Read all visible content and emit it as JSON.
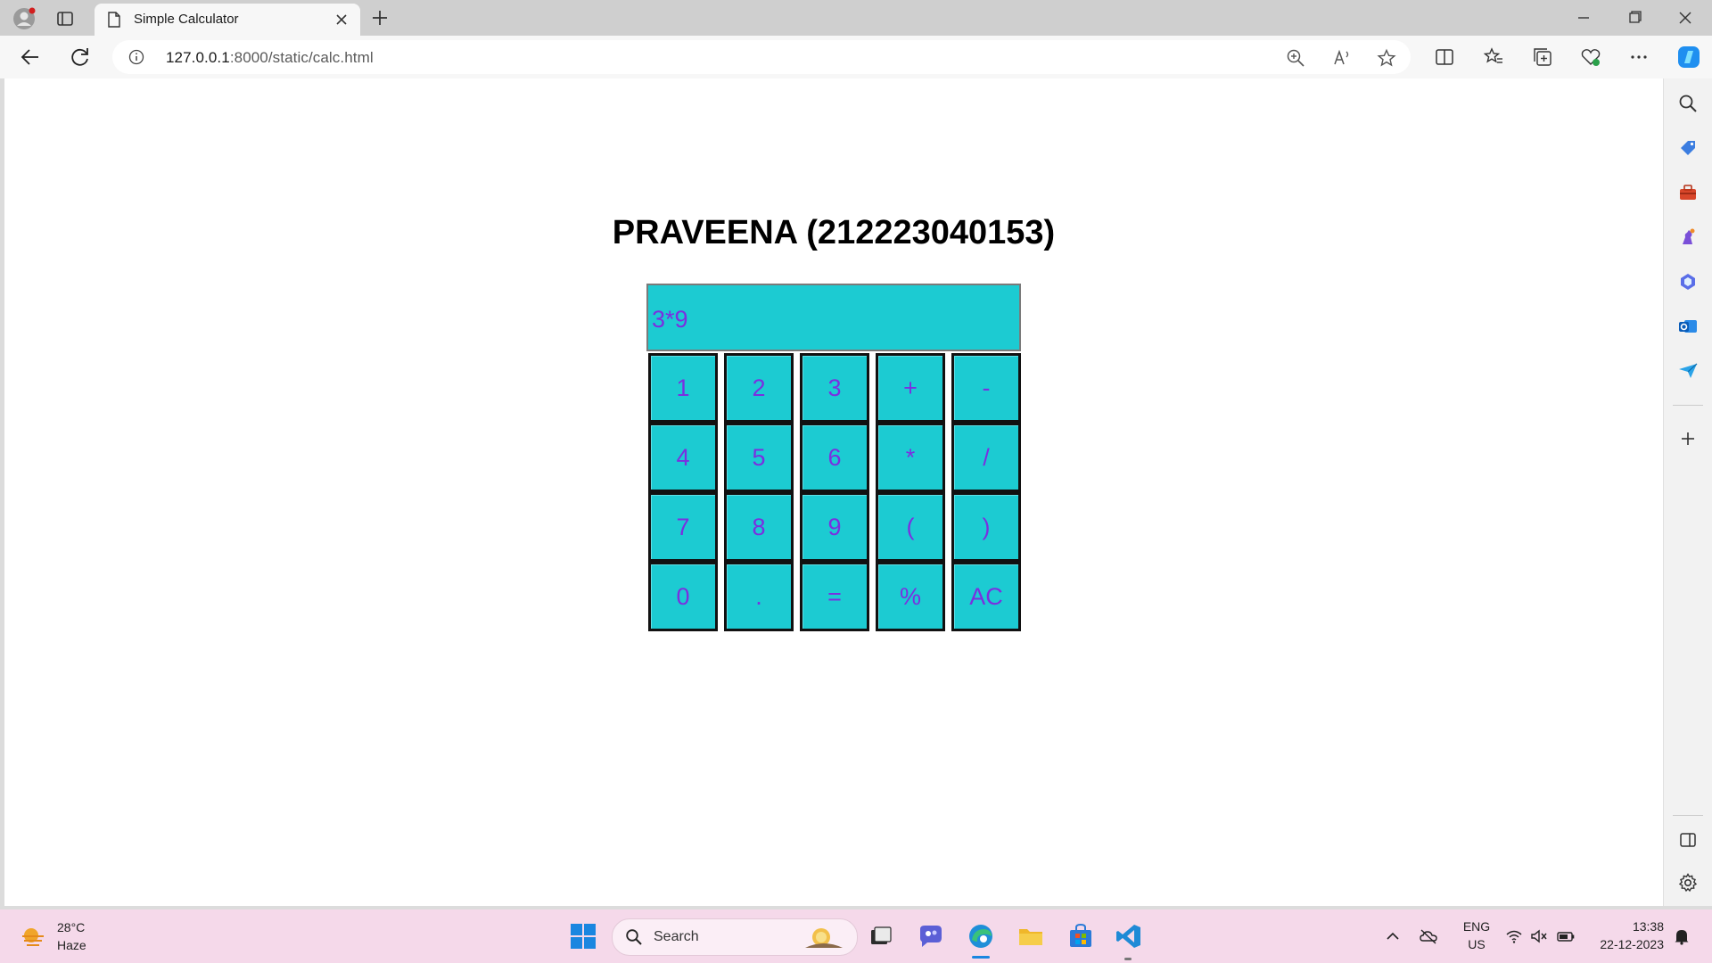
{
  "browser": {
    "tab_title": "Simple Calculator",
    "url_host": "127.0.0.1",
    "url_rest": ":8000/static/calc.html"
  },
  "page": {
    "heading": "PRAVEENA (212223040153)",
    "display_value": "3*9",
    "buttons": [
      {
        "label": "1"
      },
      {
        "label": "2"
      },
      {
        "label": "3"
      },
      {
        "label": "+"
      },
      {
        "label": "-"
      },
      {
        "label": "4"
      },
      {
        "label": "5"
      },
      {
        "label": "6"
      },
      {
        "label": "*"
      },
      {
        "label": "/"
      },
      {
        "label": "7"
      },
      {
        "label": "8"
      },
      {
        "label": "9"
      },
      {
        "label": "("
      },
      {
        "label": ")"
      },
      {
        "label": "0"
      },
      {
        "label": "."
      },
      {
        "label": "="
      },
      {
        "label": "%"
      },
      {
        "label": "AC"
      }
    ],
    "colors": {
      "button_bg": "#1ccbd2",
      "button_text": "#7b2fe0",
      "button_border": "#111111"
    }
  },
  "taskbar": {
    "weather_temp": "28°C",
    "weather_desc": "Haze",
    "search_placeholder": "Search",
    "lang_top": "ENG",
    "lang_bottom": "US",
    "time": "13:38",
    "date": "22-12-2023"
  }
}
